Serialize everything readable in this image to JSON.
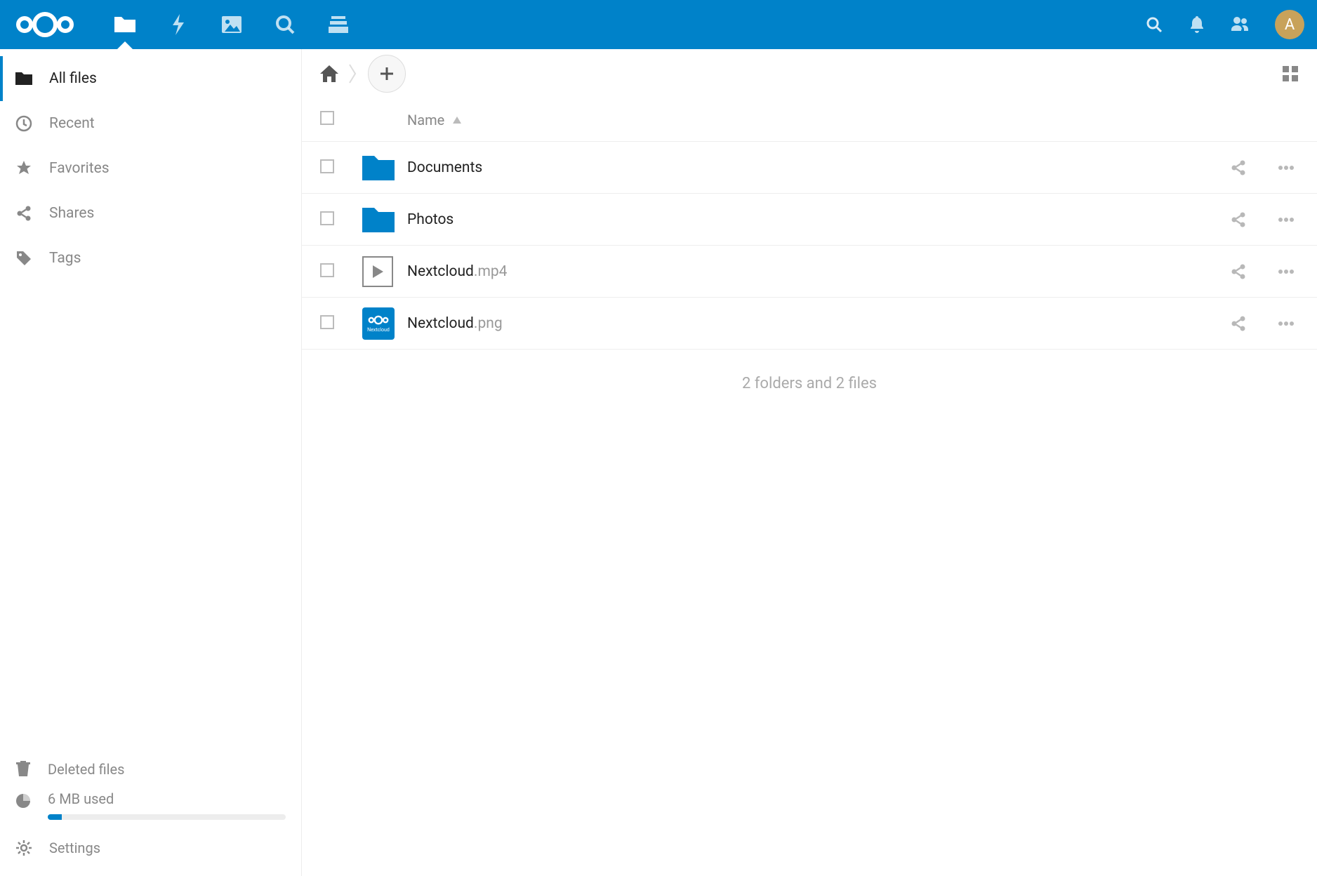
{
  "avatar_initial": "A",
  "sidebar": {
    "items": [
      {
        "label": "All files",
        "active": true
      },
      {
        "label": "Recent"
      },
      {
        "label": "Favorites"
      },
      {
        "label": "Shares"
      },
      {
        "label": "Tags"
      }
    ],
    "deleted_label": "Deleted files",
    "quota_text": "6 MB used",
    "quota_percent": 6,
    "settings_label": "Settings"
  },
  "header": {
    "name_col": "Name"
  },
  "files": [
    {
      "name": "Documents",
      "ext": "",
      "type": "folder"
    },
    {
      "name": "Photos",
      "ext": "",
      "type": "folder"
    },
    {
      "name": "Nextcloud",
      "ext": ".mp4",
      "type": "video"
    },
    {
      "name": "Nextcloud",
      "ext": ".png",
      "type": "nc-image"
    }
  ],
  "summary": "2 folders and 2 files"
}
